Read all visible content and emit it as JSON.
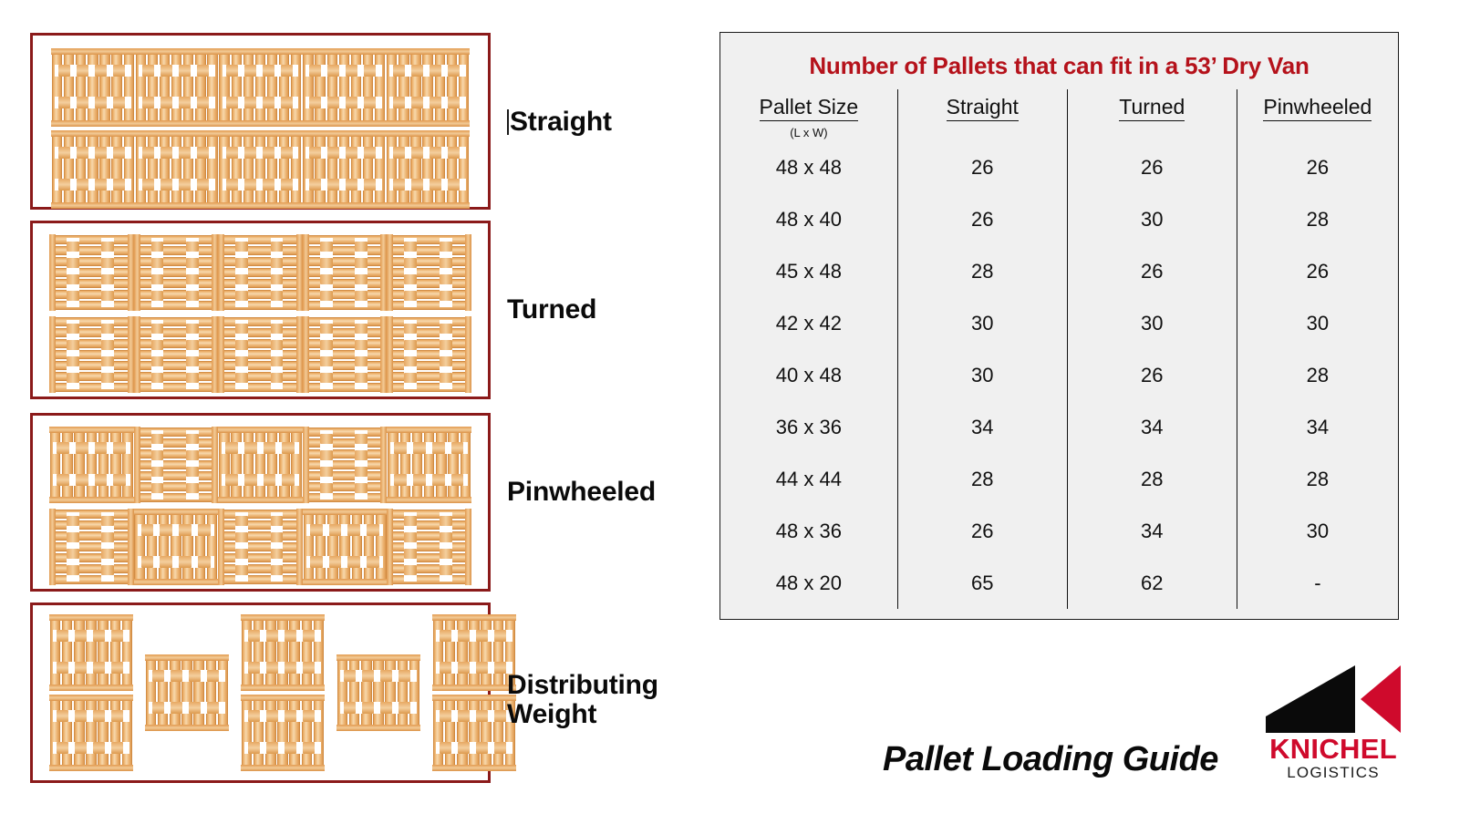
{
  "sections": [
    {
      "id": "straight",
      "label": "Straight",
      "has_caret": true,
      "rows": [
        [
          "v",
          "v",
          "v",
          "v",
          "v"
        ],
        [
          "v",
          "v",
          "v",
          "v",
          "v"
        ]
      ]
    },
    {
      "id": "turned",
      "label": "Turned",
      "has_caret": false,
      "rows": [
        [
          "h",
          "h",
          "h",
          "h",
          "h"
        ],
        [
          "h",
          "h",
          "h",
          "h",
          "h"
        ]
      ]
    },
    {
      "id": "pinwheeled",
      "label": "Pinwheeled",
      "has_caret": false,
      "rows": [
        [
          "v",
          "h",
          "v",
          "h",
          "v"
        ],
        [
          "h",
          "v",
          "h",
          "v",
          "h"
        ]
      ]
    },
    {
      "id": "distributing",
      "label": "Distributing\nWeight",
      "has_caret": false,
      "rows": [
        [
          "v",
          "",
          "v",
          "",
          "v"
        ],
        [
          "v",
          "",
          "v",
          "",
          "v"
        ]
      ],
      "middle": [
        "",
        "v",
        "",
        "v",
        ""
      ]
    }
  ],
  "table": {
    "title": "Number of Pallets that can fit in a 53’ Dry Van",
    "title_color": "#b5121b",
    "headers": [
      "Pallet Size",
      "Straight",
      "Turned",
      "Pinwheeled"
    ],
    "header_sub": "(L x W)",
    "rows": [
      {
        "size": "48 x 48",
        "straight": "26",
        "turned": "26",
        "pinwheeled": "26"
      },
      {
        "size": "48 x 40",
        "straight": "26",
        "turned": "30",
        "pinwheeled": "28"
      },
      {
        "size": "45 x 48",
        "straight": "28",
        "turned": "26",
        "pinwheeled": "26"
      },
      {
        "size": "42 x 42",
        "straight": "30",
        "turned": "30",
        "pinwheeled": "30"
      },
      {
        "size": "40 x 48",
        "straight": "30",
        "turned": "26",
        "pinwheeled": "28"
      },
      {
        "size": "36 x 36",
        "straight": "34",
        "turned": "34",
        "pinwheeled": "34"
      },
      {
        "size": "44 x 44",
        "straight": "28",
        "turned": "28",
        "pinwheeled": "28"
      },
      {
        "size": "48 x 36",
        "straight": "26",
        "turned": "34",
        "pinwheeled": "30"
      },
      {
        "size": "48 x 20",
        "straight": "65",
        "turned": "62",
        "pinwheeled": "-"
      }
    ]
  },
  "footer": {
    "title": "Pallet Loading Guide",
    "logo_name": "KNICHEL",
    "logo_sub": "LOGISTICS",
    "logo_red": "#cf0a2c",
    "logo_black": "#0a0a0a"
  },
  "colors": {
    "group_border": "#8b1a1a",
    "table_bg": "#f0f0f0",
    "wood_light": "#f7d8ac",
    "wood_dark": "#d98f43"
  }
}
